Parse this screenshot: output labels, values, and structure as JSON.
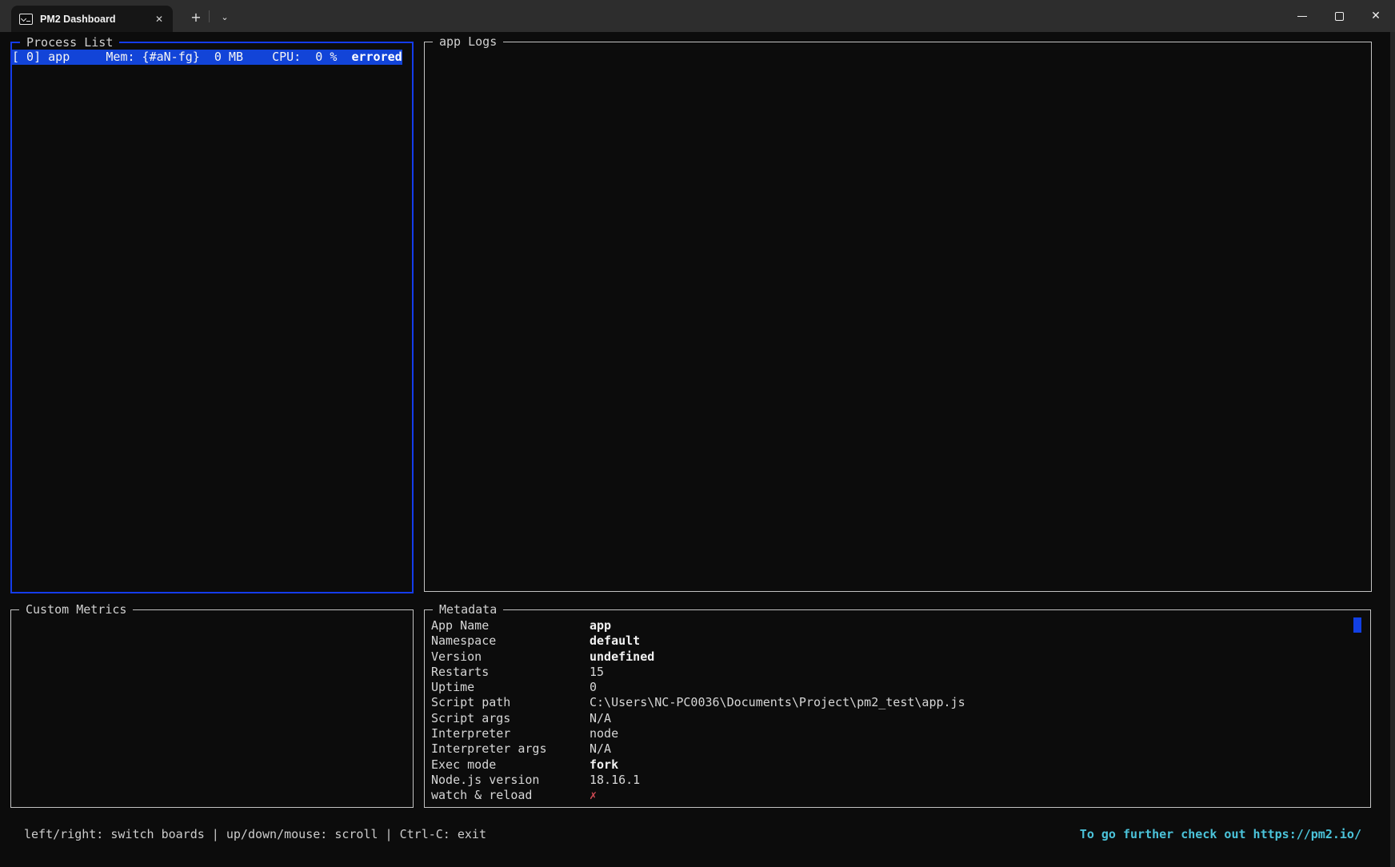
{
  "window": {
    "tab_title": "PM2 Dashboard",
    "tab_close": "✕",
    "new_tab": "+",
    "tab_dropdown": "⌄",
    "close": "✕"
  },
  "panels": {
    "process_list": {
      "title": "Process List",
      "selected_row": {
        "text": "[ 0] app     Mem: {#aN-fg}  0 MB    CPU:  0 %  ",
        "status": "errored"
      }
    },
    "app_logs": {
      "title": "app Logs"
    },
    "custom_metrics": {
      "title": "Custom Metrics"
    },
    "metadata": {
      "title": "Metadata",
      "rows": [
        {
          "label": "App Name",
          "value": "app"
        },
        {
          "label": "Namespace",
          "value": "default"
        },
        {
          "label": "Version",
          "value": "undefined"
        },
        {
          "label": "Restarts",
          "value": "15"
        },
        {
          "label": "Uptime",
          "value": "0"
        },
        {
          "label": "Script path",
          "value": "C:\\Users\\NC-PC0036\\Documents\\Project\\pm2_test\\app.js"
        },
        {
          "label": "Script args",
          "value": "N/A"
        },
        {
          "label": "Interpreter",
          "value": "node"
        },
        {
          "label": "Interpreter args",
          "value": "N/A"
        },
        {
          "label": "Exec mode",
          "value": "fork"
        },
        {
          "label": "Node.js version",
          "value": "18.16.1"
        },
        {
          "label": "watch & reload",
          "value": "✗"
        }
      ]
    }
  },
  "footer": {
    "left": "left/right: switch boards | up/down/mouse: scroll | Ctrl-C: exit",
    "right": "To go further check out https://pm2.io/"
  },
  "colors": {
    "accent_blue": "#143ceb",
    "selection_blue": "#1244d8",
    "cyan": "#4bc3da",
    "red": "#d24b55",
    "background": "#0c0c0c",
    "titlebar": "#2d2d2d"
  }
}
